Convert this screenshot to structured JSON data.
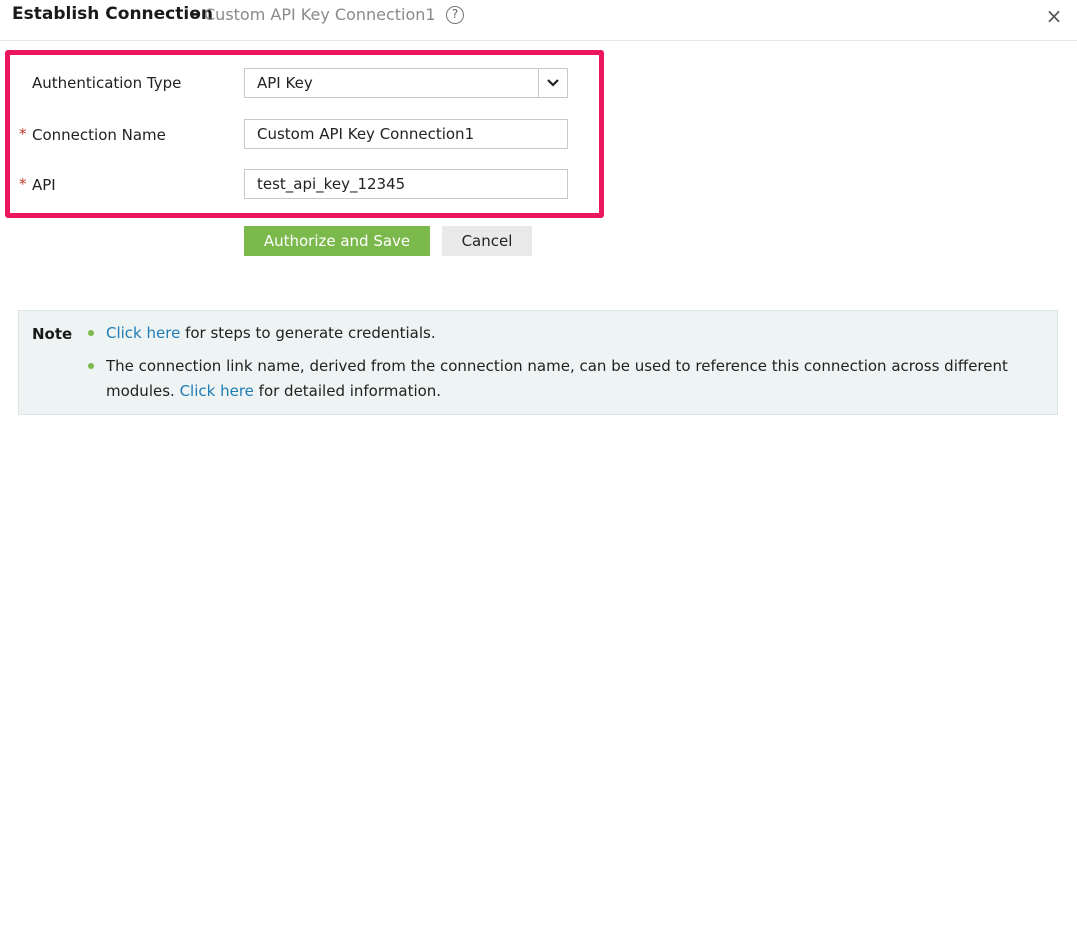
{
  "header": {
    "title": "Establish Connection",
    "separator": "-",
    "subtitle": "Custom API Key Connection1",
    "help_icon": "?",
    "close_icon": "×"
  },
  "form": {
    "auth_type": {
      "label": "Authentication Type",
      "value": "API Key",
      "arrow_icon": "chevron-down-icon"
    },
    "connection_name": {
      "label": "Connection Name",
      "required_mark": "*",
      "value": "Custom API Key Connection1"
    },
    "api": {
      "label": "API",
      "required_mark": "*",
      "value": "test_api_key_12345"
    }
  },
  "buttons": {
    "authorize_label": "Authorize and Save",
    "cancel_label": "Cancel"
  },
  "note": {
    "label": "Note",
    "line1_link": "Click here",
    "line1_text": " for steps to generate credentials.",
    "line2_text": "The connection link name, derived from the connection name, can be used to reference this connection across different",
    "line3_prefix": "modules. ",
    "line3_link": "Click here",
    "line3_suffix": " for detailed information."
  },
  "colors": {
    "highlight": "#ec1560",
    "primary": "#7cb94c",
    "link": "#1f7cb5"
  }
}
